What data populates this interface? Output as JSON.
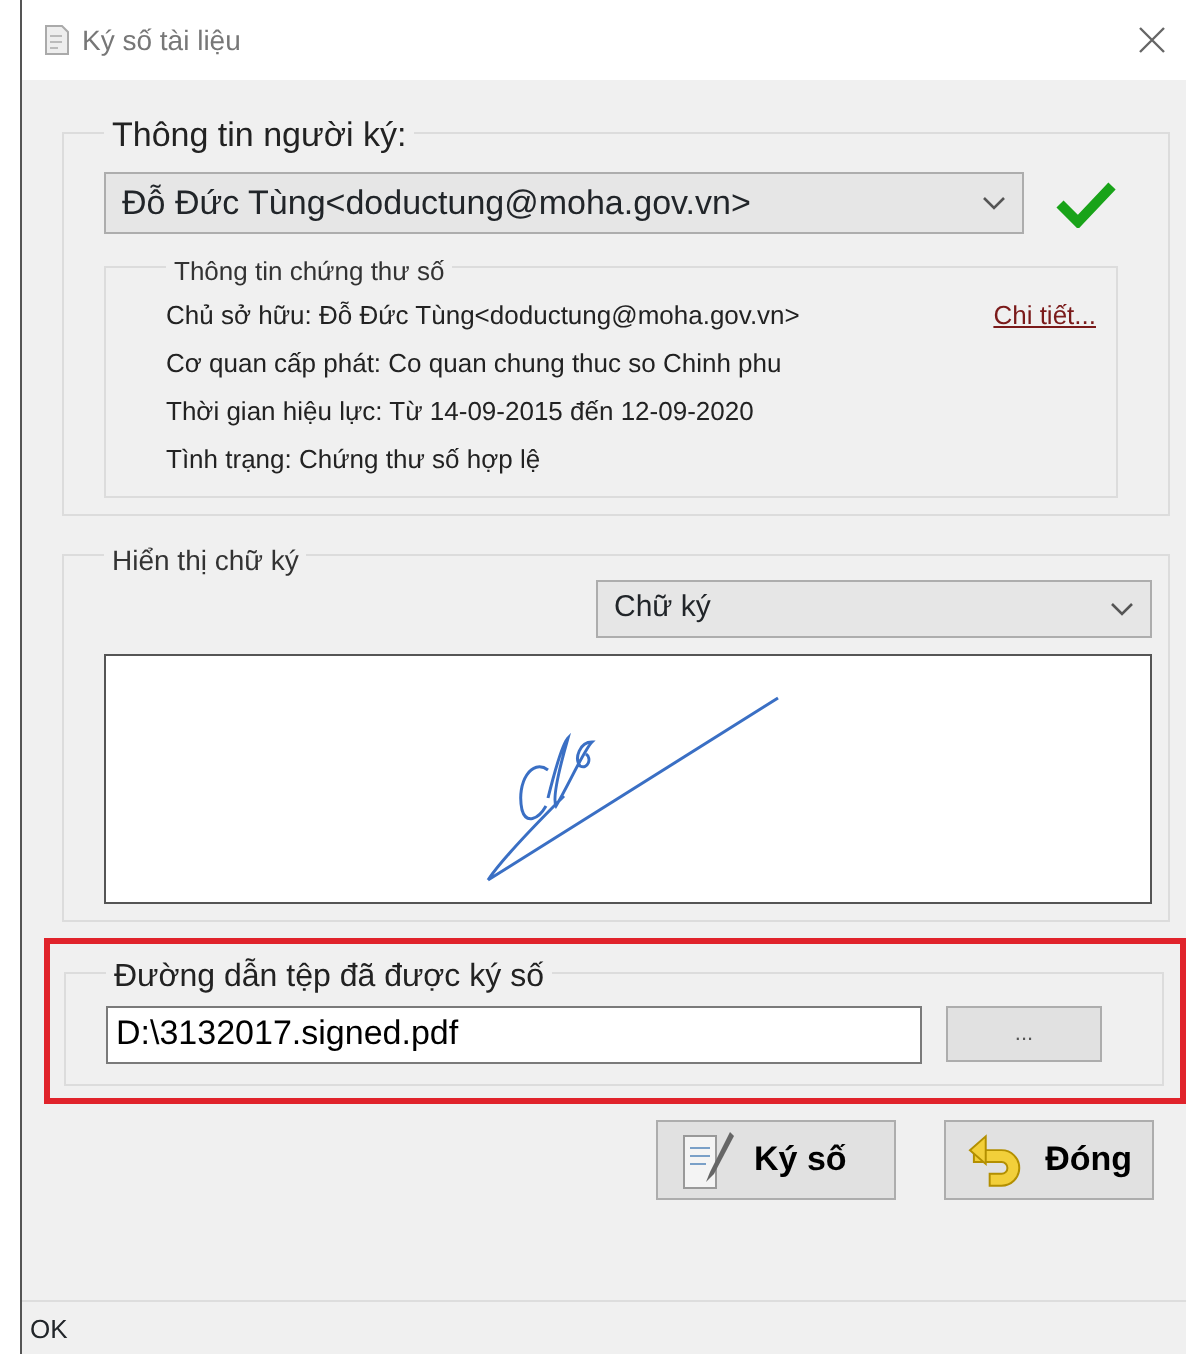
{
  "window": {
    "title": "Ký số tài liệu"
  },
  "signer": {
    "legend": "Thông tin người ký:",
    "selected_signer": "Đỗ Đức Tùng<doductung@moha.gov.vn>",
    "verified": true
  },
  "certificate": {
    "legend": "Thông tin chứng thư số",
    "details_link": "Chi tiết...",
    "lines": [
      "Chủ sở hữu: Đỗ Đức Tùng<doductung@moha.gov.vn>",
      "Cơ quan cấp phát: Co quan chung thuc so Chinh phu",
      "Thời gian hiệu lực: Từ 14-09-2015 đến 12-09-2020",
      "Tình trạng: Chứng thư số hợp lệ"
    ]
  },
  "signature_display": {
    "legend": "Hiển thị chữ ký",
    "mode": "Chữ ký"
  },
  "output": {
    "legend": "Đường dẫn tệp đã được ký số",
    "path": "D:\\3132017.signed.pdf",
    "browse": "...",
    "highlighted": true
  },
  "buttons": [
    {
      "kind": "sign",
      "label": "Ký số"
    },
    {
      "kind": "close",
      "label": "Đóng"
    }
  ],
  "status_bar": "OK"
}
